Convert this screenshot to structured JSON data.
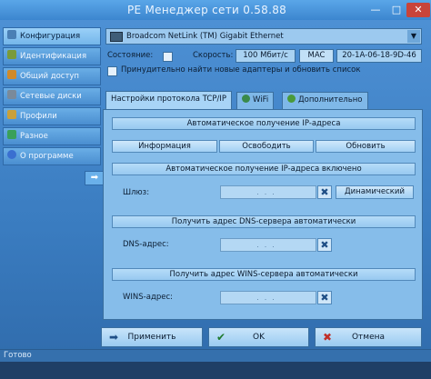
{
  "window": {
    "title": "PE Менеджер сети 0.58.88",
    "min_glyph": "—",
    "max_glyph": "□",
    "close_glyph": "✕"
  },
  "sidebar": {
    "items": [
      {
        "label": "Конфигурация",
        "icon": "config-icon",
        "color": "#4a7fb5"
      },
      {
        "label": "Идентификация",
        "icon": "id-icon",
        "color": "#7a9a3a"
      },
      {
        "label": "Общий доступ",
        "icon": "share-icon",
        "color": "#d08a2a"
      },
      {
        "label": "Сетевые диски",
        "icon": "drive-icon",
        "color": "#7a8a9a"
      },
      {
        "label": "Профили",
        "icon": "profiles-icon",
        "color": "#c9a03a"
      },
      {
        "label": "Разное",
        "icon": "misc-icon",
        "color": "#3aa05a"
      },
      {
        "label": "О программе",
        "icon": "info-icon",
        "color": "#3a6fd0"
      }
    ],
    "collapse_glyph": "➡"
  },
  "adapter": {
    "name": "Broadcom NetLink (TM) Gigabit Ethernet",
    "dropdown_glyph": "▼"
  },
  "status_row": {
    "state_label": "Состояние:",
    "speed_label": "Скорость:",
    "speed_value": "100 Мбит/с",
    "mac_button": "MAC",
    "mac_value": "20-1A-06-18-9D-46"
  },
  "force_find": {
    "label": "Принудительно найти новые адаптеры и обновить список"
  },
  "tabs": [
    {
      "label": "Настройки протокола TCP/IP"
    },
    {
      "label": "WiFi"
    },
    {
      "label": "Дополнительно"
    }
  ],
  "tcpip": {
    "auto_ip_header": "Автоматическое получение IP-адреса",
    "info_button": "Информация",
    "release_button": "Освободить",
    "renew_button": "Обновить",
    "auto_ip_enabled": "Автоматическое получение IP-адреса включено",
    "gateway_label": "Шлюз:",
    "ip_placeholder": "...",
    "dynamic_button": "Динамический",
    "dns_header": "Получить адрес DNS-сервера автоматически",
    "dns_label": "DNS-адрес:",
    "wins_header": "Получить адрес WINS-сервера автоматически",
    "wins_label": "WINS-адрес:",
    "clear_glyph": "✖"
  },
  "footer": {
    "apply_button": "Применить",
    "ok_button": "OK",
    "cancel_button": "Отмена",
    "apply_glyph": "➡",
    "ok_glyph": "✔",
    "cancel_glyph": "✖"
  },
  "statusbar": {
    "text": "Готово"
  }
}
